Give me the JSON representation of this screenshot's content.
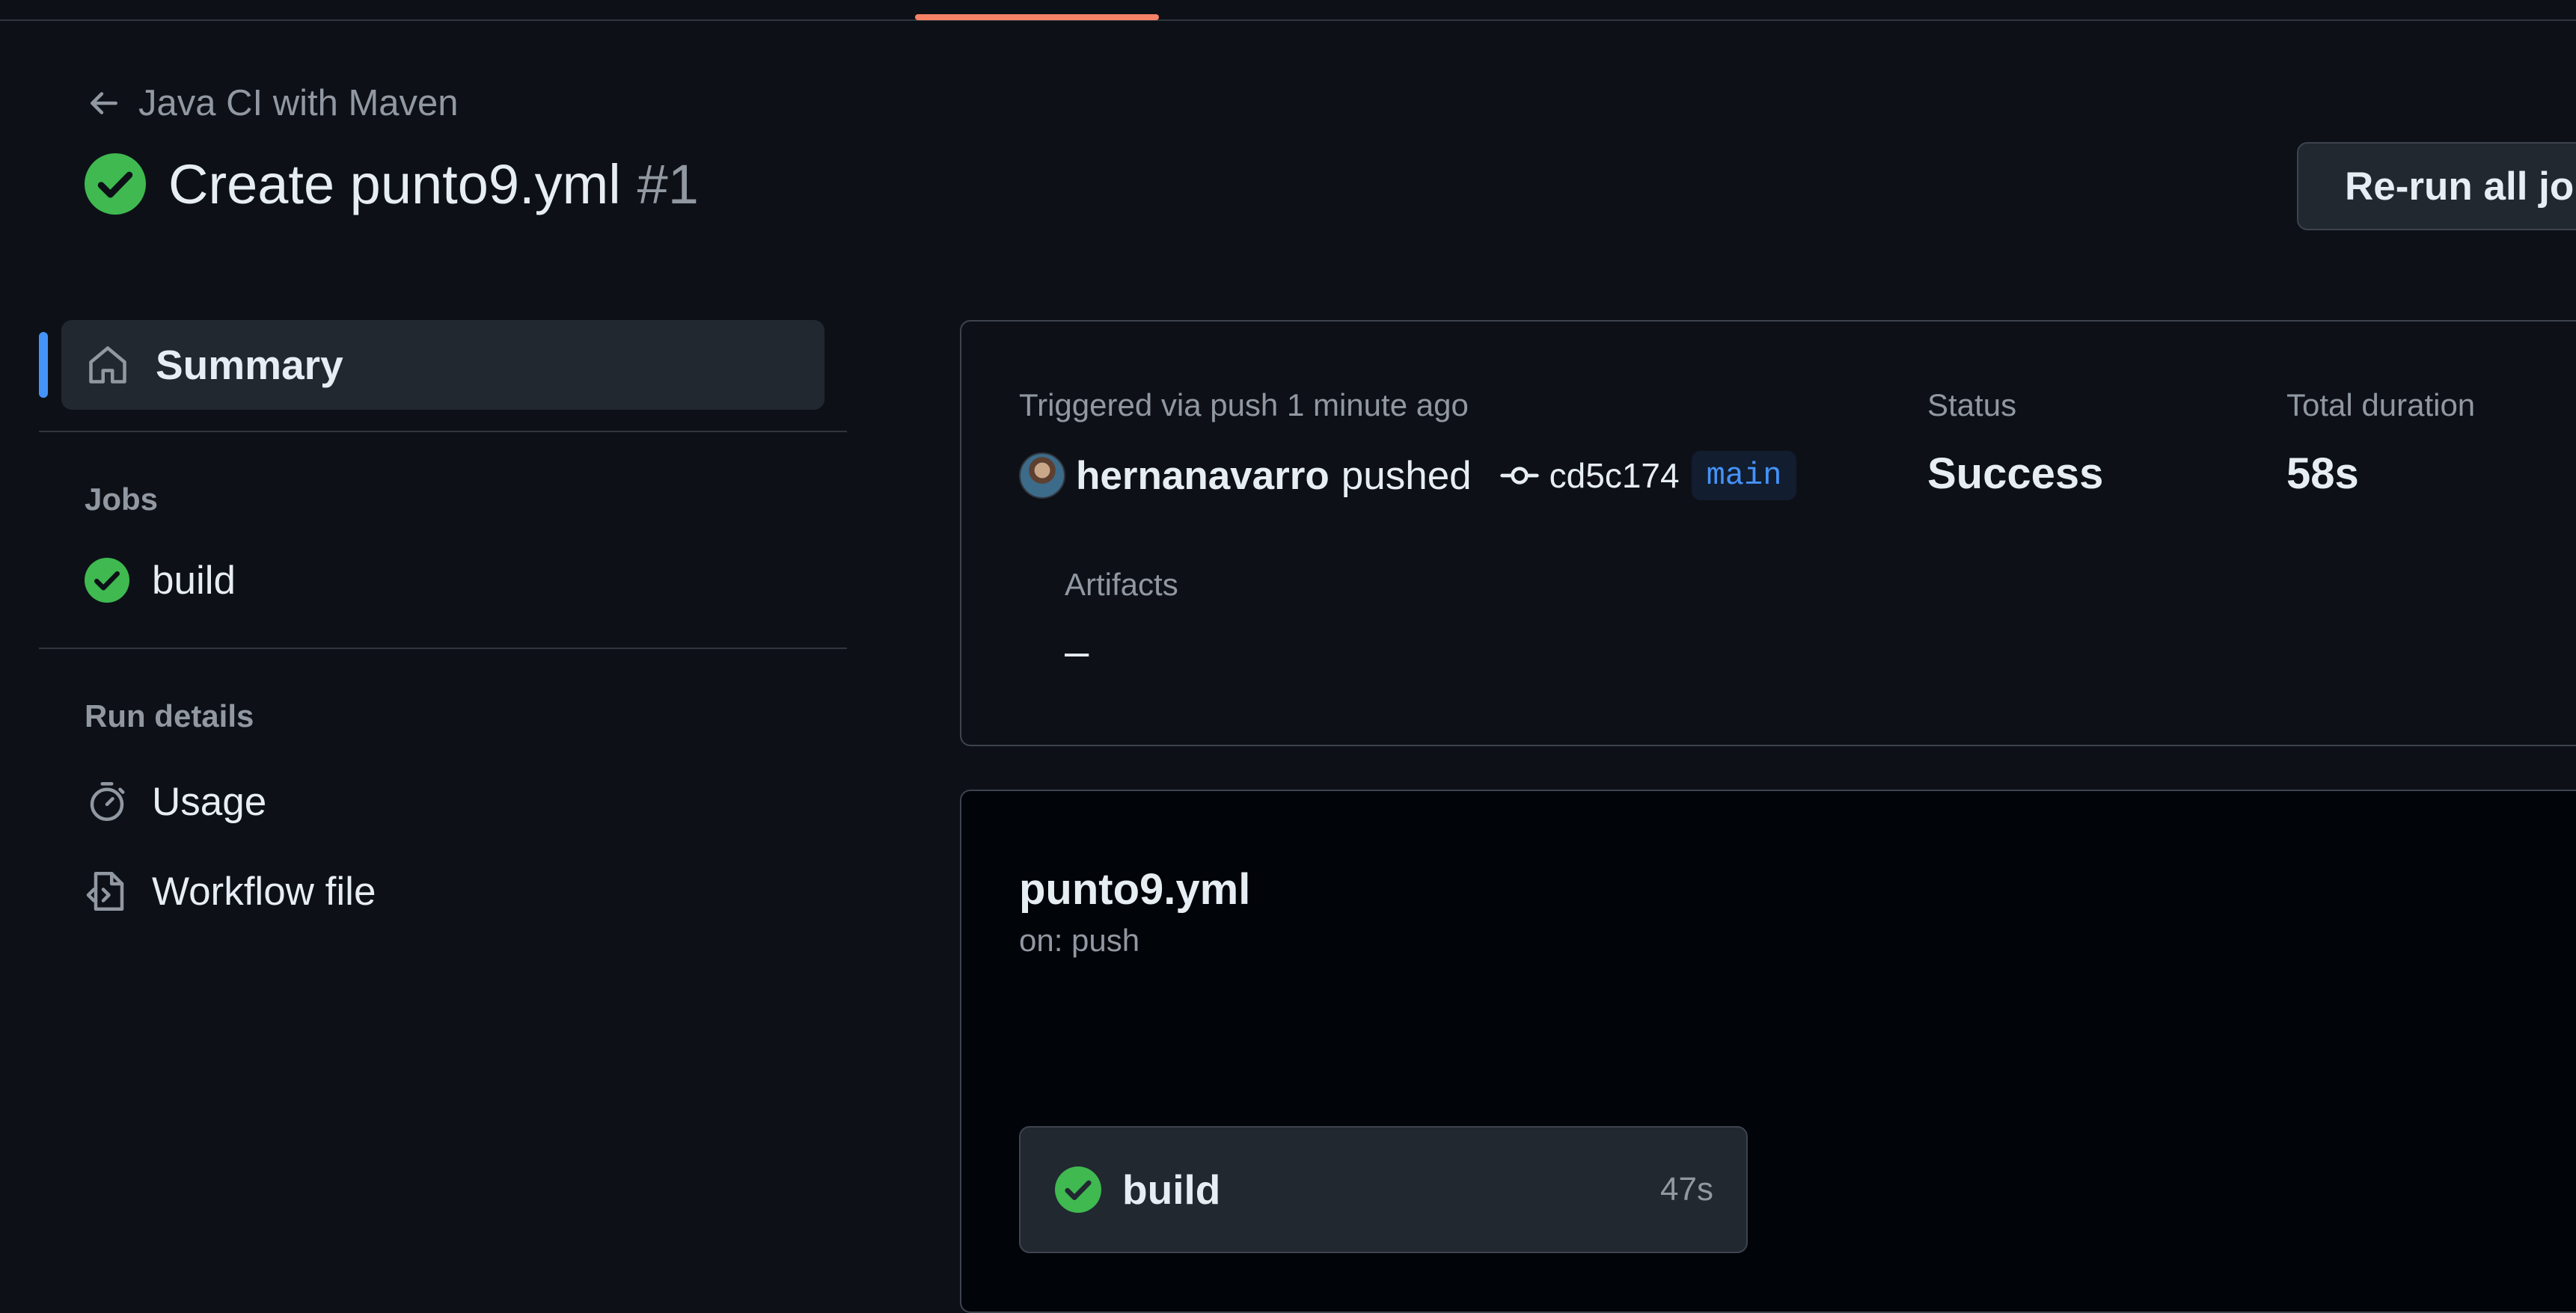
{
  "header": {
    "workflow_name": "Java CI with Maven",
    "run_title": "Create punto9.yml",
    "run_number": "#1",
    "rerun_label": "Re-run all jobs"
  },
  "sidebar": {
    "summary_label": "Summary",
    "jobs_title": "Jobs",
    "jobs": [
      {
        "label": "build",
        "status": "success"
      }
    ],
    "run_details_title": "Run details",
    "run_details": [
      {
        "label": "Usage",
        "icon": "stopwatch-icon"
      },
      {
        "label": "Workflow file",
        "icon": "file-code-icon"
      }
    ]
  },
  "summary": {
    "trigger_text": "Triggered via push 1 minute ago",
    "actor": "hernanavarro",
    "action": "pushed",
    "commit_sha": "cd5c174",
    "branch": "main",
    "status_label": "Status",
    "status_value": "Success",
    "duration_label": "Total duration",
    "duration_value": "58s",
    "artifacts_label": "Artifacts",
    "artifacts_value": "–"
  },
  "graph": {
    "file_name": "punto9.yml",
    "trigger": "on: push",
    "jobs": [
      {
        "name": "build",
        "duration": "47s",
        "status": "success"
      }
    ]
  },
  "colors": {
    "background": "#0d1117",
    "success": "#3fb950",
    "accent": "#4493f8",
    "active_tab_underline": "#f78166"
  }
}
